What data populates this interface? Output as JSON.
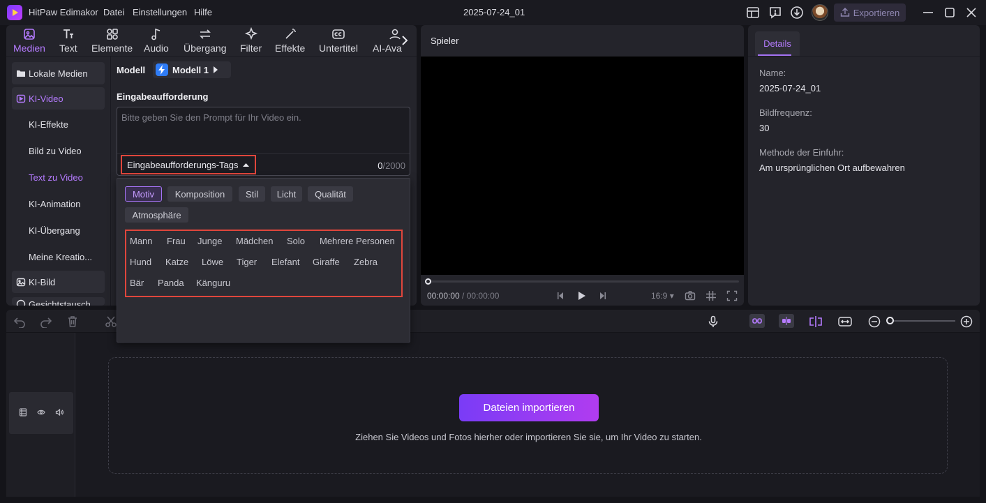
{
  "titlebar": {
    "app_name": "HitPaw Edimakor",
    "menu": [
      "Datei",
      "Einstellungen",
      "Hilfe"
    ],
    "project_title": "2025-07-24_01",
    "export_label": "Exportieren"
  },
  "toolbar": {
    "tabs": [
      "Medien",
      "Text",
      "Elemente",
      "Audio",
      "Übergang",
      "Filter",
      "Effekte",
      "Untertitel",
      "AI-Ava"
    ],
    "active": "Medien"
  },
  "sidebar": {
    "items": [
      "Lokale Medien",
      "KI-Video",
      "KI-Effekte",
      "Bild zu Video",
      "Text zu Video",
      "KI-Animation",
      "KI-Übergang",
      "Meine Kreatio...",
      "KI-Bild",
      "Gesichtstausch"
    ],
    "selected": "Text zu Video"
  },
  "generator": {
    "model_label": "Modell",
    "model_value": "Modell 1",
    "prompt_label": "Eingabeaufforderung",
    "prompt_placeholder": "Bitte geben Sie den Prompt für Ihr Video ein.",
    "tags_toggle_label": "Eingabeaufforderungs-Tags",
    "count_current": "0",
    "count_max": "/2000"
  },
  "tags_dropdown": {
    "categories": [
      "Motiv",
      "Komposition",
      "Stil",
      "Licht",
      "Qualität",
      "Atmosphäre"
    ],
    "active_category": "Motiv",
    "tags": [
      "Mann",
      "Frau",
      "Junge",
      "Mädchen",
      "Solo",
      "Mehrere Personen",
      "Hund",
      "Katze",
      "Löwe",
      "Tiger",
      "Elefant",
      "Giraffe",
      "Zebra",
      "Bär",
      "Panda",
      "Känguru"
    ]
  },
  "player": {
    "title": "Spieler",
    "time_current": "00:00:00",
    "time_total": " / 00:00:00",
    "aspect_ratio": "16:9"
  },
  "details": {
    "tab_label": "Details",
    "name_label": "Name:",
    "name_value": "2025-07-24_01",
    "framerate_label": "Bildfrequenz:",
    "framerate_value": "30",
    "import_method_label": "Methode der Einfuhr:",
    "import_method_value": "Am ursprünglichen Ort aufbewahren"
  },
  "timeline": {
    "import_button": "Dateien importieren",
    "drop_hint": "Ziehen Sie Videos und Fotos hierher oder importieren Sie sie, um Ihr Video zu starten."
  },
  "colors": {
    "accent": "#b57bff",
    "highlight_border": "#e0463c",
    "import_gradient_start": "#7a3cf6",
    "import_gradient_end": "#b13cf0"
  }
}
